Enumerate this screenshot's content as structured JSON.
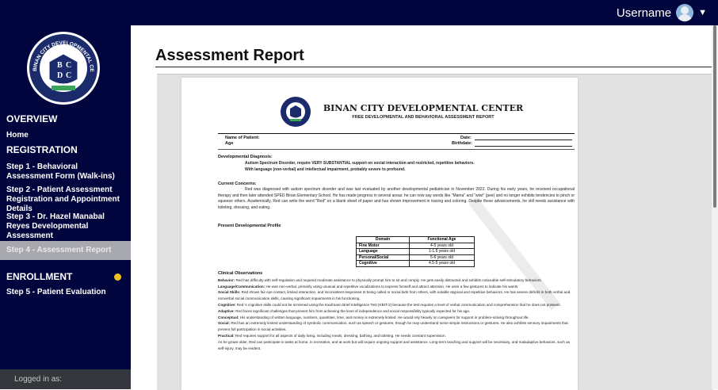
{
  "header": {
    "username": "Username"
  },
  "sidebar": {
    "logo_text": "BINAN CITY DEVELOPMENTAL CENTER",
    "logo_letters": [
      "B",
      "C",
      "D",
      "C"
    ],
    "sections": {
      "overview": "OVERVIEW",
      "registration": "REGISTRATION",
      "enrollment": "ENROLLMENT"
    },
    "items": {
      "home": "Home",
      "step1": "Step 1 - Behavioral Assessment Form (Walk-ins)",
      "step2": "Step 2 - Patient Assessment Registration and Appointment Details",
      "step3": "Step 3 - Dr. Hazel Manabal Reyes Developmental Assessment",
      "step4": "Step 4 - Assessment Report",
      "step5": "Step 5 - Patient Evaluation"
    },
    "logged_in": "Logged in as:",
    "enrollment_dot_color": "#f2c11d"
  },
  "main": {
    "title": "Assessment Report",
    "doc": {
      "title": "BINAN CITY DEVELOPMENTAL CENTER",
      "subtitle": "FREE DEVELOPMENTAL AND BEHAVIORAL ASSESSMENT REPORT",
      "name_label": "Name of Patient:",
      "age_label": "Age",
      "date_label": "Date:",
      "birthdate_label": "Birthdate:",
      "diag_head": "Developmental Diagnosis:",
      "diag_line1": "Autism Spectrum Disorder, require VERY SUBSTANTIAL support on social interaction and restricted, repetitive behaviors.",
      "diag_line2": "With language (non-verbal) and intellectual impairment, probably severe to profound.",
      "concerns_head": "Current Concerns:",
      "concerns_text": "Red was diagnosed with autism spectrum disorder and was last evaluated by another developmental pediatrician in November 2022. During his early years, he received occupational therapy and then later attended SPED Binan Elementary School. He has made progress in several areas: he can now say words like \"Mama\" and \"wiwi\" (pee) and no longer exhibits tendencies to pinch or squeeze others. Academically, Red can write the word \"Red\" on a blank sheet of paper and has shown improvement in tracing and coloring. Despite these advancements, he still needs assistance with toileting, dressing, and eating.",
      "profile_head": "Present Developmental Profile",
      "table_headers": [
        "Domain",
        "Functional Age"
      ],
      "table_rows": [
        [
          "Fine Motor",
          "4-5 years old"
        ],
        [
          "Language",
          "1-1.5 years old"
        ],
        [
          "Personal/Social",
          "5-6 years old"
        ],
        [
          "Cognitive",
          "4.5-5 years old"
        ]
      ],
      "clinical_head": "Clinical Observations",
      "observations": [
        {
          "label": "Behavior:",
          "text": " Red has difficulty with self-regulation and required moderate assistance to physically prompt him to sit and comply. He gets easily distracted and exhibits noticeable self-stimulatory behaviors."
        },
        {
          "label": "Language/Communication:",
          "text": " He was non-verbal, primarily using unusual and repetitive vocalizations to express himself and attract attention. He uses a few gestures to indicate his wants"
        },
        {
          "label": "Social Skills:",
          "text": " Red shows fair eye contact, limited interaction, and inconsistent responses to being called or social bids from others, with notable atypical and repetitive behaviors. He has severe deficits in both verbal and nonverbal social communication skills, causing significant impairments in his functioning."
        },
        {
          "label": "Cognitive:",
          "text": " Red 's cognitive skills could not be screened using the Kaufmann Brief Intelligence Test (KBIT-2) because the test requires a level of verbal communication and comprehension that he does not possess."
        },
        {
          "label": "Adaptive:",
          "text": " Red faces significant challenges that prevent him from achieving the level of independence and social responsibility typically expected for his age."
        },
        {
          "label": "Conceptual:",
          "text": " His understanding of written language, numbers, quantities, time, and money is extremely limited. He would rely heavily on caregivers for support in problem-solving throughout life."
        },
        {
          "label": "Social:",
          "text": " Red has an extremely limited understanding of symbolic communication, such as speech or gestures, though he may understand some simple instructions or gestures. He also exhibits sensory impairments that prevent full participation in social activities."
        },
        {
          "label": "Practical:",
          "text": " Red requires support for all aspects of daily living, including meals, dressing, bathing, and toileting. He needs constant supervision."
        },
        {
          "label": "",
          "text": "As he grows older, Red can participate in tasks at home, in recreation, and at work but will require ongoing support and assistance. Long-term teaching and support will be necessary, and maladaptive behaviors, such as self-injury, may be evident."
        }
      ]
    }
  }
}
